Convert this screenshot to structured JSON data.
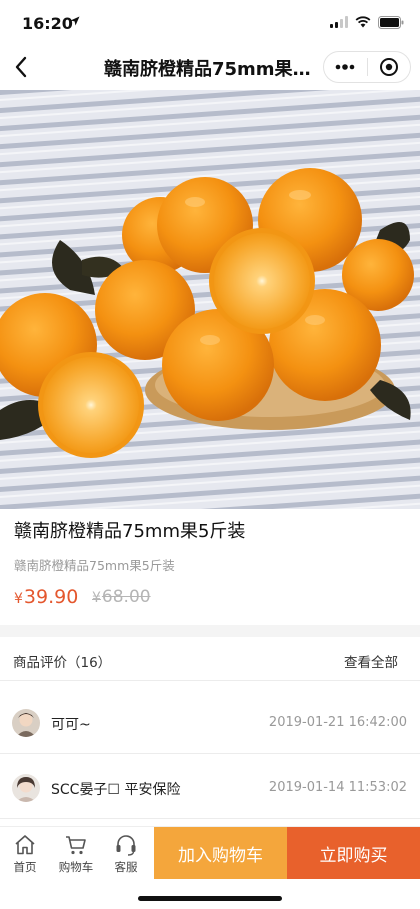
{
  "status_bar": {
    "time": "16:20"
  },
  "nav": {
    "title": "赣南脐橙精品75mm果5斤装"
  },
  "product": {
    "name": "赣南脐橙精品75mm果5斤装",
    "subtitle": "赣南脐橙精品75mm果5斤装",
    "currency": "¥",
    "price": "39.90",
    "original_price": "68.00"
  },
  "reviews": {
    "title": "商品评价（16）",
    "view_all": "查看全部",
    "items": [
      {
        "name": "可可~",
        "time": "2019-01-21 16:42:00"
      },
      {
        "name": "SCC晏子☐ 平安保险",
        "time": "2019-01-14 11:53:02"
      }
    ]
  },
  "bottom_bar": {
    "home_label": "首页",
    "cart_label": "购物车",
    "service_label": "客服",
    "add_to_cart": "加入购物车",
    "buy_now": "立即购买"
  },
  "colors": {
    "price": "#e4572e",
    "add_to_cart_bg": "#f4a63c",
    "buy_now_bg": "#e8612c"
  },
  "icons": [
    "location-arrow-icon",
    "signal-icon",
    "wifi-icon",
    "battery-icon",
    "back-arrow-icon",
    "more-dots-icon",
    "close-circle-icon",
    "home-icon",
    "cart-icon",
    "headset-icon"
  ]
}
